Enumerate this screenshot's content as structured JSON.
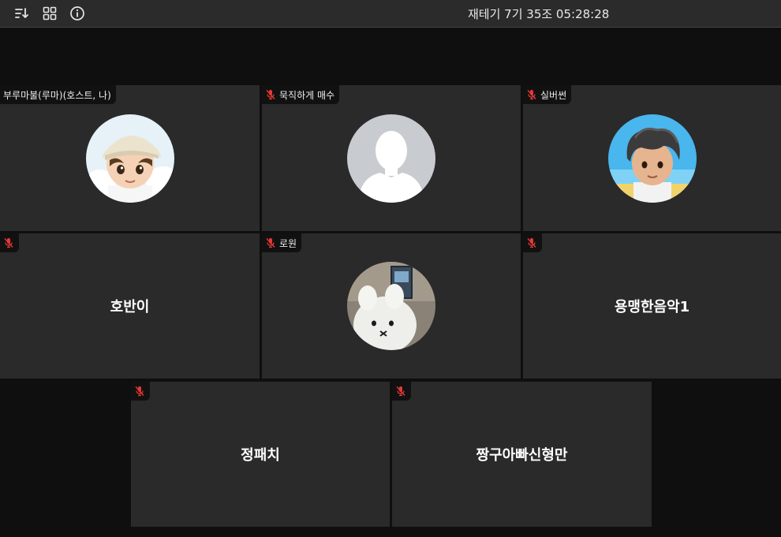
{
  "toolbar": {
    "sort_icon": "sort-descending-icon",
    "grid_icon": "grid-view-icon",
    "info_icon": "info-icon",
    "title": "재테기 7기 35조 05:28:28"
  },
  "participants": [
    {
      "name": "부루마불(루마)(호스트, 나)",
      "muted": false,
      "display": "avatar",
      "avatar": "boy-cap-avatar"
    },
    {
      "name": "묵직하게 매수",
      "muted": true,
      "display": "avatar",
      "avatar": "default-person-avatar"
    },
    {
      "name": "실버썬",
      "muted": true,
      "display": "avatar",
      "avatar": "boy-beach-avatar"
    },
    {
      "name": "호반이",
      "muted": true,
      "display": "name"
    },
    {
      "name": "로원",
      "muted": true,
      "display": "avatar",
      "avatar": "plush-toy-photo-avatar"
    },
    {
      "name": "용맹한음악1",
      "muted": true,
      "display": "name"
    },
    {
      "name": "정패치",
      "muted": true,
      "display": "name"
    },
    {
      "name": "짱구아빠신형만",
      "muted": true,
      "display": "name"
    }
  ],
  "colors": {
    "background": "#0f0f0f",
    "tile": "#2a2a2a",
    "label_bg": "#111111",
    "muted_mic": "#e53935",
    "topbar": "#2b2b2b"
  }
}
